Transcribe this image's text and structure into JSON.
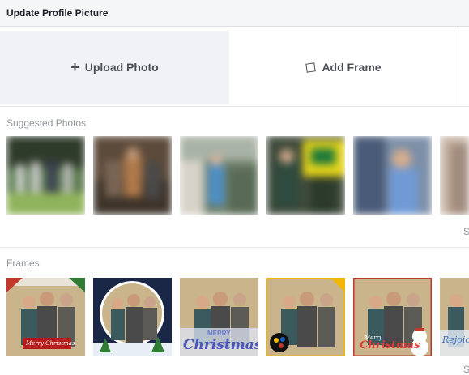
{
  "header": {
    "title": "Update Profile Picture"
  },
  "actions": {
    "upload_label": "Upload Photo",
    "frame_label": "Add Frame"
  },
  "suggested": {
    "label": "Suggested Photos",
    "see_more": "S",
    "items": [
      {
        "icon": "photo-1"
      },
      {
        "icon": "photo-2"
      },
      {
        "icon": "photo-3"
      },
      {
        "icon": "photo-4"
      },
      {
        "icon": "photo-5"
      },
      {
        "icon": "photo-6"
      }
    ]
  },
  "frames": {
    "label": "Frames",
    "items": [
      {
        "name": "merry-christmas-banner",
        "text": "Merry Christmas"
      },
      {
        "name": "snow-globe",
        "text": ""
      },
      {
        "name": "merry-christmas-blue",
        "text_top": "MERRY",
        "text": "Christmas"
      },
      {
        "name": "steelers",
        "text": ""
      },
      {
        "name": "merry-christmas-snowman",
        "text_top": "Merry",
        "text": "Christmas"
      },
      {
        "name": "rejoice-partial",
        "text": "Rejoice"
      }
    ]
  },
  "colors": {
    "header_bg": "#f5f6f7",
    "upload_bg": "#f0f2f5",
    "muted_text": "#90949c",
    "button_text": "#4b4f56"
  }
}
